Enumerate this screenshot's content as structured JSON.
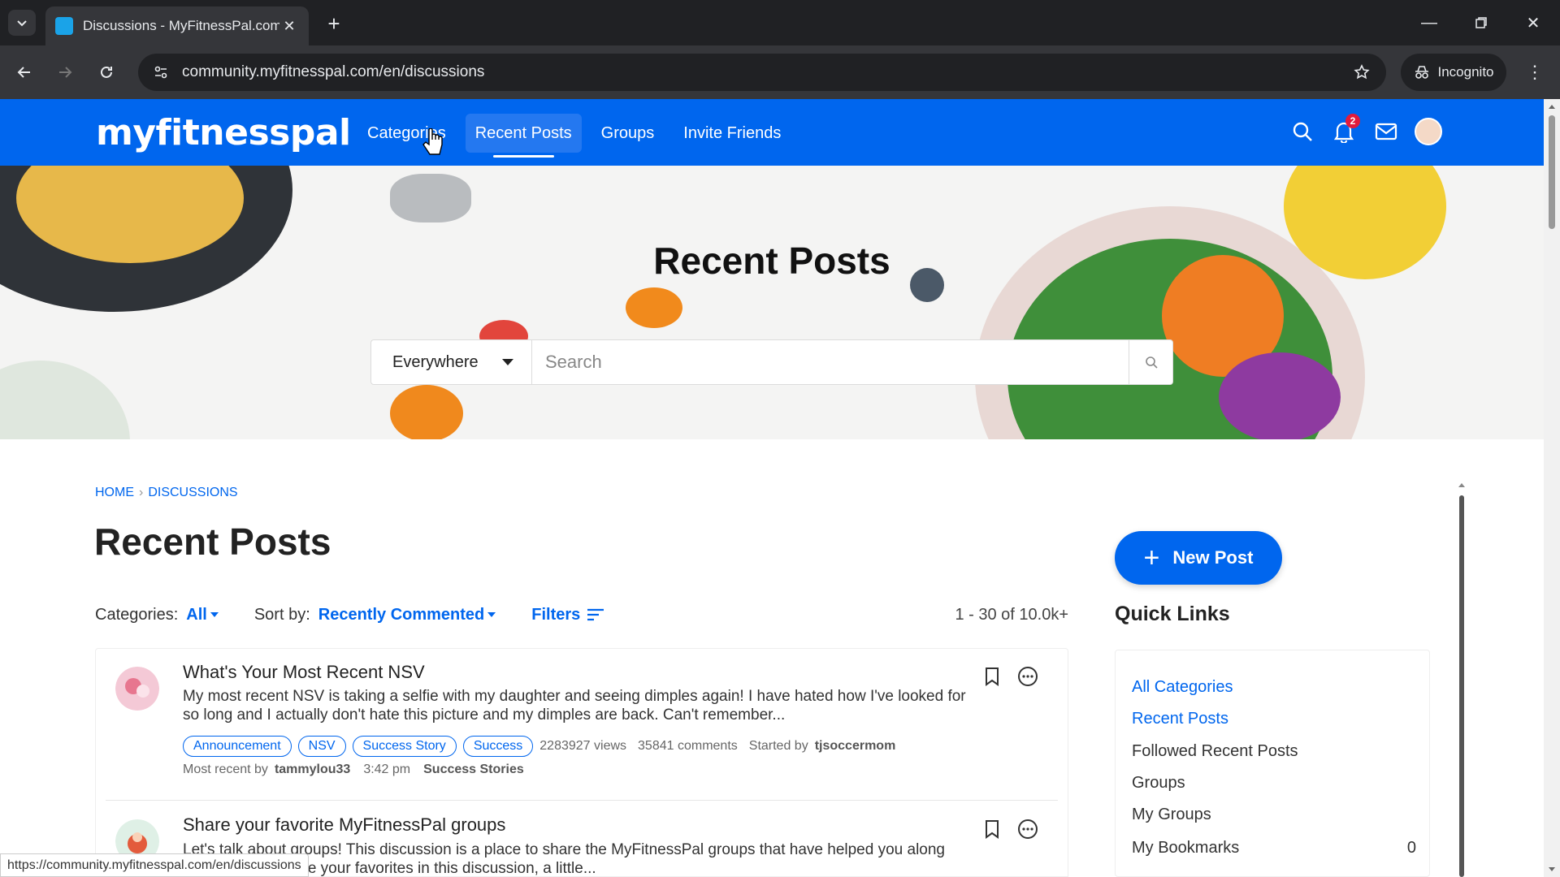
{
  "browser": {
    "tab_title": "Discussions - MyFitnessPal.com",
    "url": "community.myfitnesspal.com/en/discussions",
    "incognito_label": "Incognito",
    "status_url": "https://community.myfitnesspal.com/en/discussions"
  },
  "header": {
    "logo": "myfitnesspal",
    "nav": [
      "Categories",
      "Recent Posts",
      "Groups",
      "Invite Friends"
    ],
    "active_nav": "Recent Posts",
    "notification_count": "2",
    "brand_color": "#0066ee"
  },
  "hero": {
    "title": "Recent Posts",
    "scope": "Everywhere",
    "search_placeholder": "Search"
  },
  "breadcrumb": [
    "HOME",
    "DISCUSSIONS"
  ],
  "page_title": "Recent Posts",
  "filters": {
    "categories_label": "Categories:",
    "categories_value": "All",
    "sort_label": "Sort by:",
    "sort_value": "Recently Commented",
    "filters_label": "Filters",
    "count": "1 - 30 of 10.0k+"
  },
  "posts": [
    {
      "title": "What's Your Most Recent NSV",
      "excerpt": "My most recent NSV is taking a selfie with my daughter and seeing dimples again! I have hated how I've looked for so long and I actually don't hate this picture and my dimples are back. Can't remember...",
      "tags": [
        "Announcement",
        "NSV",
        "Success Story",
        "Success"
      ],
      "views": "2283927 views",
      "comments": "35841 comments",
      "started_by_label": "Started by",
      "started_by": "tjsoccermom",
      "most_recent_label": "Most recent by",
      "most_recent_by": "tammylou33",
      "time": "3:42 pm",
      "category": "Success Stories"
    },
    {
      "title": "Share your favorite MyFitnessPal groups",
      "excerpt": "Let's talk about groups! This discussion is a place to share the MyFitnessPal groups that have helped you along your journey. Share your favorites in this discussion, a little..."
    }
  ],
  "sidebar": {
    "new_post": "New Post",
    "quick_links_title": "Quick Links",
    "quick_links": [
      {
        "label": "All Categories",
        "count": ""
      },
      {
        "label": "Recent Posts",
        "count": ""
      },
      {
        "label": "Followed Recent Posts",
        "count": ""
      },
      {
        "label": "Groups",
        "count": ""
      },
      {
        "label": "My Groups",
        "count": ""
      },
      {
        "label": "My Bookmarks",
        "count": "0"
      }
    ]
  },
  "icons": [
    "search-icon",
    "bell-icon",
    "mail-icon",
    "bookmark-icon",
    "more-icon",
    "filter-icon",
    "star-icon",
    "plus-icon"
  ]
}
